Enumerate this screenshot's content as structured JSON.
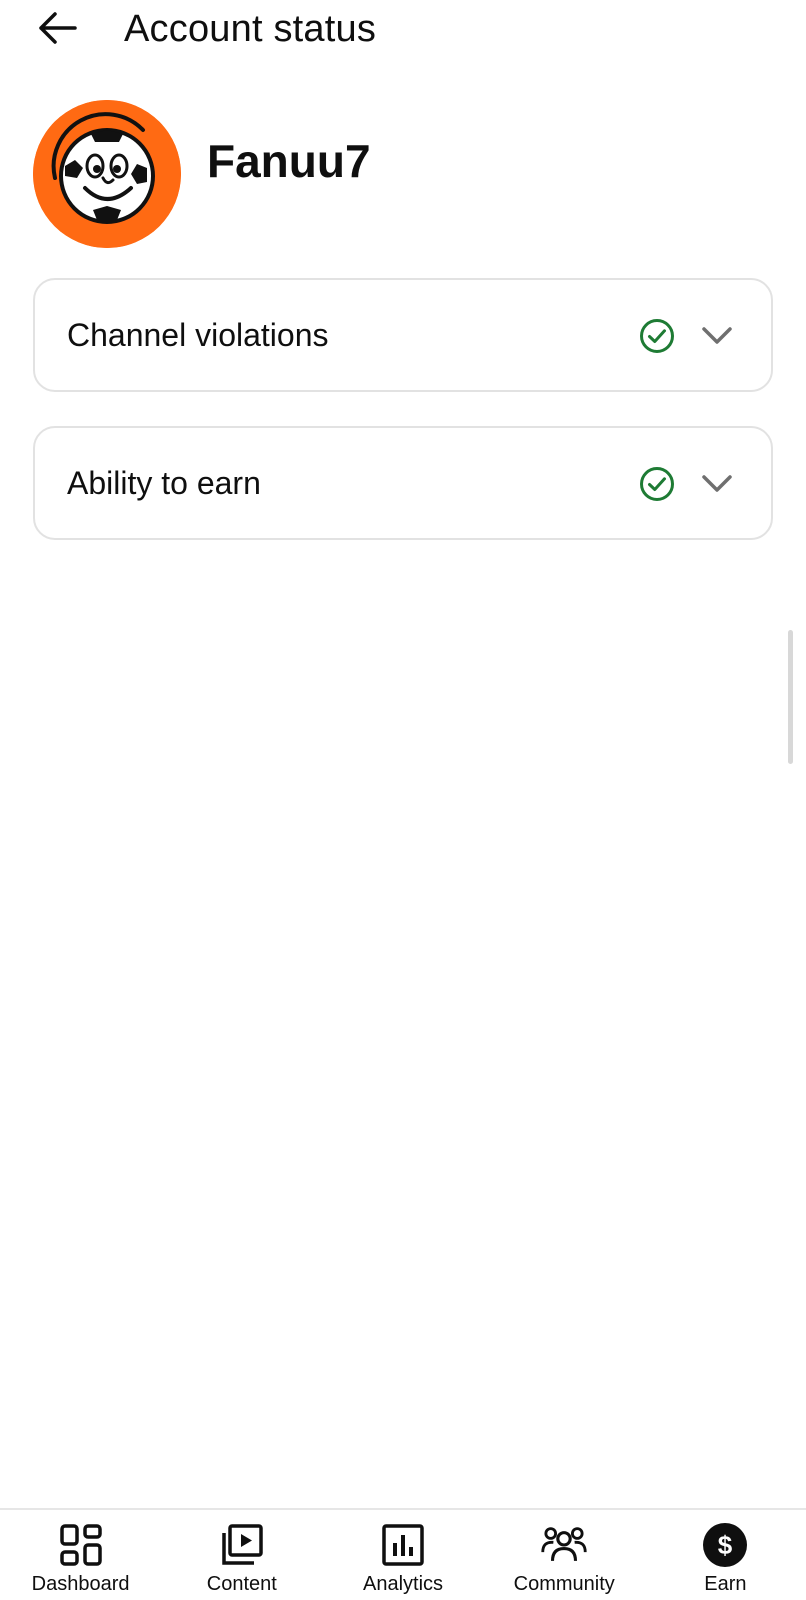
{
  "header": {
    "title": "Account status",
    "back_icon": "arrow-left-icon"
  },
  "profile": {
    "channel_name": "Fanuu7",
    "avatar_icon": "soccer-ball-mascot-avatar",
    "avatar_bg": "#ff6a13"
  },
  "status_cards": [
    {
      "label": "Channel violations",
      "status_icon": "check-circle-icon",
      "expand_icon": "chevron-down-icon"
    },
    {
      "label": "Ability to earn",
      "status_icon": "check-circle-icon",
      "expand_icon": "chevron-down-icon"
    }
  ],
  "bottom_nav": {
    "items": [
      {
        "label": "Dashboard",
        "icon": "dashboard-icon"
      },
      {
        "label": "Content",
        "icon": "content-icon"
      },
      {
        "label": "Analytics",
        "icon": "analytics-icon"
      },
      {
        "label": "Community",
        "icon": "community-icon"
      },
      {
        "label": "Earn",
        "icon": "earn-dollar-icon",
        "selected": true
      }
    ]
  },
  "colors": {
    "status_ok": "#1e7b34",
    "chevron": "#6f6f6f",
    "text": "#0f0f0f",
    "card_border": "#e2e2e2"
  }
}
